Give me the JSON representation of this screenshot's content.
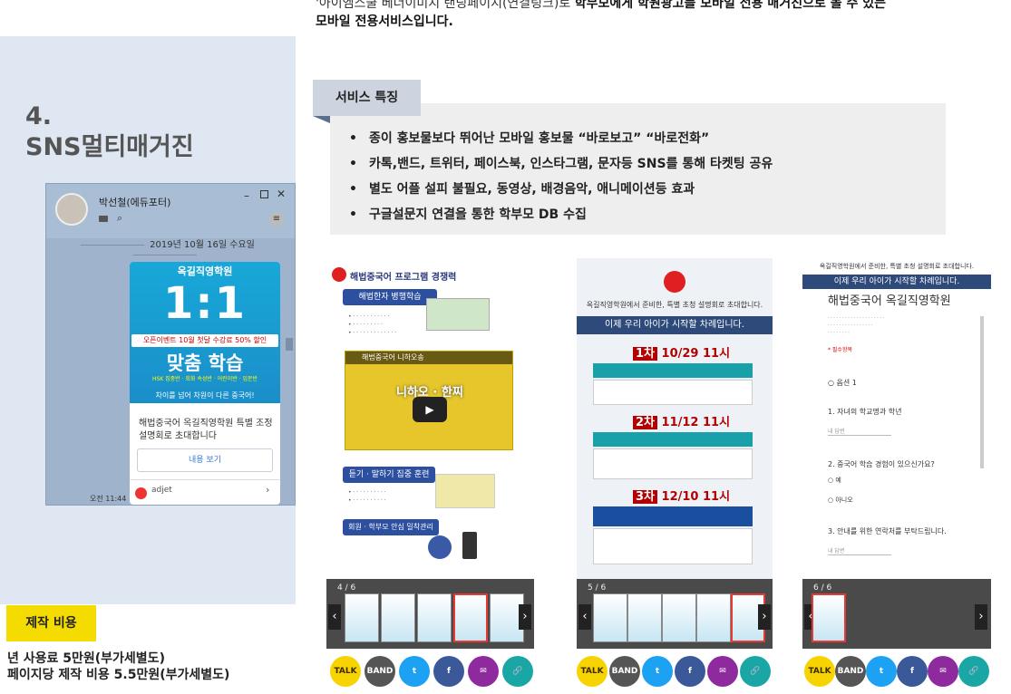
{
  "intro": {
    "line1_plain": "'아이엠스쿨 베너이미지 랜딩페이지(연결링크)로 ",
    "line1_bold": "학부모에게 학원광고를 모바일 전용 매거진으로 볼 수 있는",
    "line2_bold": "모바일 전용서비스입니다."
  },
  "section": {
    "number": "4.",
    "title": "SNS멀티매거진"
  },
  "messenger": {
    "sender": "박선철(에듀포터)",
    "date": "2019년 10월 16일 수요일",
    "card_school": "옥길직영학원",
    "card_big": "1:1",
    "card_event": "오픈이벤트 10월 첫달 수강료 50% 할인",
    "card_match": "맞춤 학습",
    "card_tags": "HSK 집중반 · 회화 속성반 · 어린이반 · 입문반",
    "card_sub": "차이를 넘어 차원이 다른 중국어!",
    "card_msg": "해법중국어 옥길직영학원 특별 조정 설명회로 초대합니다",
    "card_btn": "내용 보기",
    "ad_label": "adjet",
    "timestamp": "오전 11:44",
    "icons": {
      "minimize": "minimize-icon",
      "maximize": "maximize-icon",
      "close": "close-icon",
      "menu": "hamburger-menu-icon",
      "search": "search-icon",
      "folder": "folder-icon"
    }
  },
  "cost": {
    "label": "제작 비용",
    "line1": "년 사용료 5만원(부가세별도)",
    "line2": "페이지당 제작 비용 5.5만원(부가세별도)"
  },
  "features": {
    "heading": "서비스 특징",
    "items": [
      "종이 홍보물보다 뛰어난 모바일 홍보물 “바로보고” “바로전화”",
      "카톡,밴드, 트위터, 페이스북, 인스타그램, 문자등 SNS를 통해 타켓팅 공유",
      "별도 어플 설피 불필요, 동영상, 배경음악, 애니메이션등 효과",
      "구글설문지 연결을 통한 학부모 DB 수집"
    ]
  },
  "phones": [
    {
      "counter": "4 / 6",
      "title": "해법중국어 프로그램 경쟁력",
      "sections": [
        "해법한자 병행학습",
        "듣기 · 말하기 집중 훈련",
        "회원 · 학부모 안심 밀착관리"
      ],
      "video_caption": "해법중국어 니하오송",
      "video_text": "니하오 · 한찌"
    },
    {
      "counter": "5 / 6",
      "school": "옥길직영학원에서 준비한, 특별 초청 설명회로 초대합니다.",
      "headline": "이제 우리 아이가 시작할 차례입니다.",
      "sessions": [
        {
          "num": "1차",
          "date": "10/29",
          "time": "11시"
        },
        {
          "num": "2차",
          "date": "11/12",
          "time": "11시"
        },
        {
          "num": "3차",
          "date": "12/10",
          "time": "11시"
        }
      ]
    },
    {
      "counter": "6 / 6",
      "school": "옥길직영학원에서 준비한, 특별 초청 설명회로 초대합니다.",
      "headline": "이제 우리 아이가 시작할 차례입니다.",
      "form_title": "해법중국어 옥길직영학원",
      "required": "* 필수항목",
      "questions": [
        "1. 자녀의 학교명과 학년",
        "2. 중국어 학습 경험이 있으신가요?",
        "3. 안내를 위한 연락처를 부탁드립니다."
      ],
      "options": [
        "예",
        "아니오"
      ],
      "placeholder": "내 답변"
    }
  ],
  "share_buttons": [
    {
      "label": "TALK",
      "color": "#f7d400",
      "icon": "kakaotalk-icon"
    },
    {
      "label": "BAND",
      "color": "#555555",
      "icon": "band-icon"
    },
    {
      "label": "t",
      "color": "#1da1f2",
      "icon": "twitter-icon"
    },
    {
      "label": "f",
      "color": "#3b5998",
      "icon": "facebook-icon"
    },
    {
      "label": "✉",
      "color": "#8e2a9e",
      "icon": "mail-icon"
    },
    {
      "label": "🔗",
      "color": "#1ba6a6",
      "icon": "link-icon"
    }
  ]
}
